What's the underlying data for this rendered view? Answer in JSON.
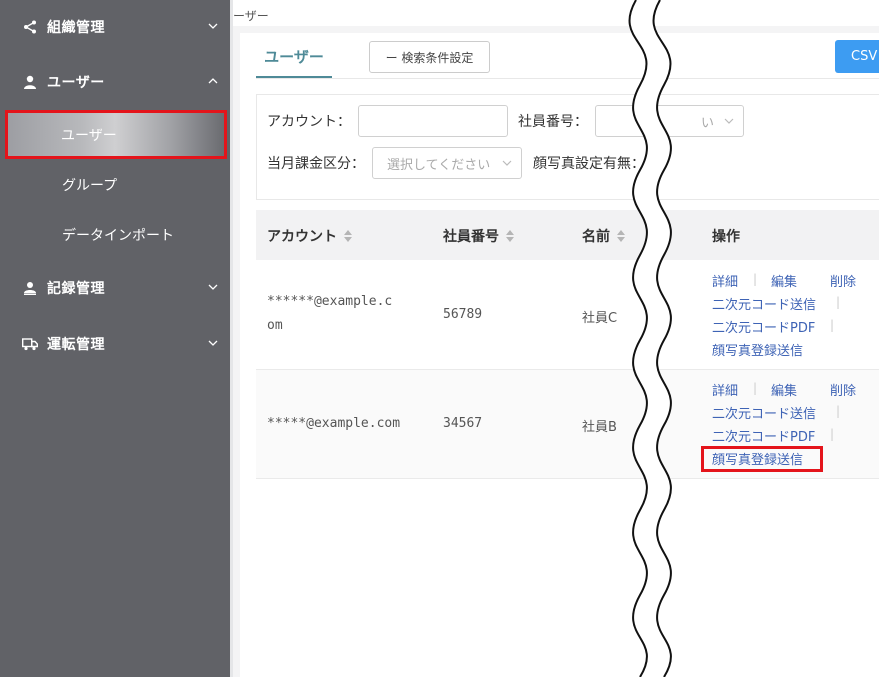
{
  "sidebar": {
    "menus": [
      {
        "label": "組織管理",
        "icon": "share-icon"
      },
      {
        "label": "ユーザー",
        "icon": "user-icon"
      },
      {
        "label": "記録管理",
        "icon": "user-record-icon"
      },
      {
        "label": "運転管理",
        "icon": "truck-icon"
      }
    ],
    "sub_items": [
      "ユーザー",
      "グループ",
      "データインポート"
    ]
  },
  "breadcrumb": "ーザー",
  "tabs": {
    "active": "ユーザー"
  },
  "toolbar": {
    "search_toggle": "ー 検索条件設定",
    "csv_button": "CSV"
  },
  "filters": {
    "account_label": "アカウント：",
    "employee_no_label": "社員番号：",
    "employee_select_partial": "い",
    "billing_label": "当月課金区分：",
    "billing_placeholder": "選択してください",
    "face_photo_label": "顔写真設定有無："
  },
  "table": {
    "headers": {
      "account": "アカウント",
      "employee_no": "社員番号",
      "name": "名前",
      "actions": "操作"
    },
    "rows": [
      {
        "account_l1": "******@example.c",
        "account_l2": "om",
        "employee_no": "56789",
        "name": "社員C"
      },
      {
        "account_l1": "*****@example.com",
        "account_l2": "",
        "employee_no": "34567",
        "name": "社員B"
      }
    ],
    "actions": {
      "detail": "詳細",
      "edit": "編集",
      "delete": "削除",
      "qr_send": "二次元コード送信",
      "qr_pdf": "二次元コードPDF",
      "face_send": "顔写真登録送信",
      "divider": "|"
    }
  },
  "colors": {
    "sidebar_bg": "#616267",
    "accent": "#4e8a97",
    "link": "#3e63b5",
    "highlight": "#e4141b",
    "primary_button": "#3d9cf2"
  }
}
